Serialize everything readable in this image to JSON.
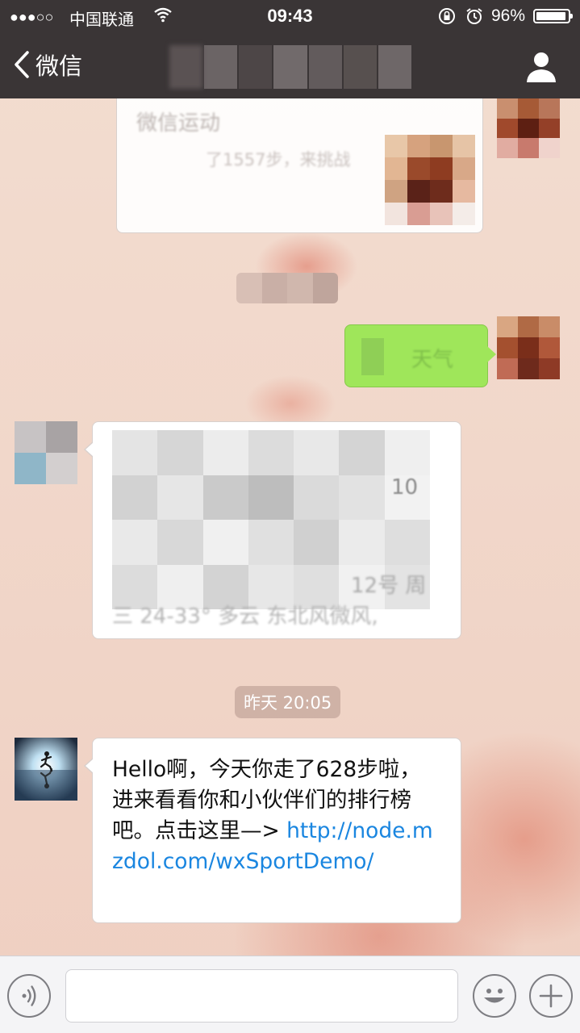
{
  "status_bar": {
    "signal": "●●●○○",
    "carrier": "中国联通",
    "time": "09:43",
    "battery_percent": "96%",
    "battery_level": 0.96
  },
  "nav": {
    "back_label": "微信",
    "title": ""
  },
  "chat": {
    "partial_card_title": "微信运动",
    "partial_card_snippet": "了1557步，来挑战",
    "outgoing_snippet": "天气",
    "weather_snippet_1": "10",
    "weather_snippet_2": "12号 周",
    "weather_snippet_3": "三 24-33° 多云 东北风微风,",
    "timestamp": "昨天 20:05",
    "message": {
      "text": "Hello啊，今天你走了628步啦，进来看看你和小伙伴们的排行榜吧。点击这里—> ",
      "link": "http://node.mzdol.com/wxSportDemo/"
    }
  },
  "input_bar": {
    "placeholder": ""
  },
  "icons": {
    "voice": "voice-icon",
    "emoji": "emoji-icon",
    "add": "plus-icon",
    "profile": "person-icon",
    "back": "chevron-left-icon"
  },
  "colors": {
    "bar_bg": "#3a3536",
    "link": "#1a86e0",
    "outgoing_bubble": "#9fe65a"
  }
}
